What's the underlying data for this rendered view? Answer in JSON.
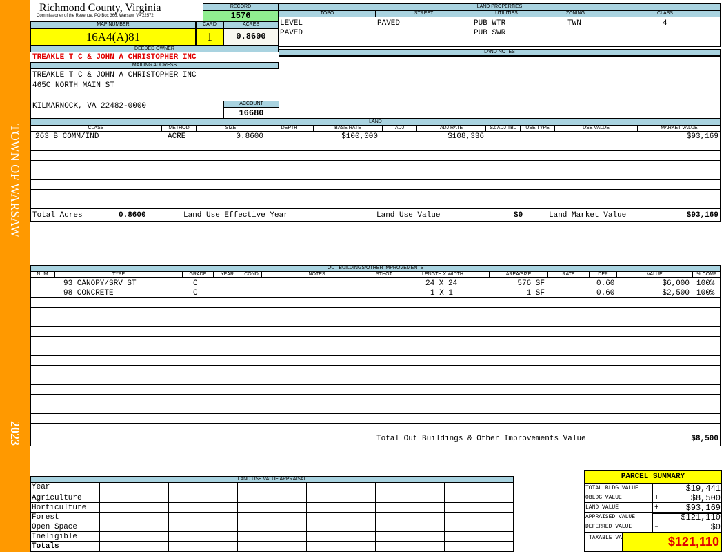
{
  "sidebar": {
    "town": "TOWN OF WARSAW",
    "year": "2023",
    "color": "#ff9900"
  },
  "header": {
    "county": "Richmond County, Virginia",
    "commissioner": "Commissioner of the Revenue, PO Box 366, Warsaw, VA 22572",
    "record_label": "RECORD",
    "record": "1576",
    "map_label": "MAP NUMBER",
    "map_number": "16A4(A)81",
    "card_label": "CARD",
    "card": "1",
    "acres_label": "ACRES",
    "acres": "0.8600"
  },
  "owner": {
    "label": "DEEDED OWNER",
    "name": "TREAKLE T C & JOHN A CHRISTOPHER INC",
    "mailing_label": "MAILING ADDRESS",
    "line1": "TREAKLE T C & JOHN A CHRISTOPHER INC",
    "line2": "465C NORTH MAIN ST",
    "line3": "KILMARNOCK, VA 22482-0000",
    "account_label": "ACCOUNT",
    "account": "16680"
  },
  "land_props": {
    "title": "LAND PROPERTIES",
    "headers": [
      "TOPO",
      "STREET",
      "UTILITIES",
      "ZONING",
      "CLASS"
    ],
    "topo": [
      "LEVEL",
      "PAVED"
    ],
    "street": "PAVED",
    "utilities": [
      "PUB WTR",
      "PUB SWR"
    ],
    "zoning": "TWN",
    "class": "4"
  },
  "land_notes": {
    "title": "LAND NOTES"
  },
  "land": {
    "title": "LAND",
    "headers": [
      "CLASS",
      "METHOD",
      "SIZE",
      "DEPTH",
      "BASE RATE",
      "ADJ",
      "ADJ RATE",
      "SZ ADJ TBL",
      "USE TYPE",
      "USE VALUE",
      "MARKET VALUE"
    ],
    "row": {
      "class": "263 B COMM/IND",
      "method": "ACRE",
      "size": "0.8600",
      "base_rate": "$100,000",
      "adj_rate": "$108,336",
      "market": "$93,169"
    },
    "total_acres_label": "Total Acres",
    "total_acres": "0.8600",
    "effective_year_label": "Land Use Effective Year",
    "use_value_label": "Land Use Value",
    "use_value": "$0",
    "market_value_label": "Land Market Value",
    "market_value": "$93,169"
  },
  "outbuildings": {
    "title": "OUT BUILDINGS/OTHER IMPROVEMENTS",
    "headers": [
      "NUM",
      "TYPE",
      "GRADE",
      "YEAR",
      "COND",
      "NOTES",
      "STHGT",
      "LENGTH X WIDTH",
      "AREA/SIZE",
      "RATE",
      "DEP",
      "VALUE",
      "% COMP"
    ],
    "rows": [
      {
        "type": "93 CANOPY/SRV ST",
        "grade": "C",
        "lw": "24 X 24",
        "area": "576 SF",
        "dep": "0.60",
        "value": "$6,000",
        "comp": "100%"
      },
      {
        "type": "98 CONCRETE",
        "grade": "C",
        "lw": "1 X 1",
        "area": "1 SF",
        "dep": "0.60",
        "value": "$2,500",
        "comp": "100%"
      }
    ],
    "total_label": "Total Out Buildings & Other Improvements Value",
    "total": "$8,500"
  },
  "luva": {
    "title": "LAND USE VALUE APPRAISAL",
    "rows": [
      "Year",
      "Agriculture",
      "Horticulture",
      "Forest",
      "Open Space",
      "Ineligible",
      "Totals"
    ]
  },
  "summary": {
    "title": "PARCEL SUMMARY",
    "rows": [
      {
        "label": "TOTAL BLDG VALUE",
        "op": "",
        "value": "$19,441"
      },
      {
        "label": "OBLDG VALUE",
        "op": "+",
        "value": "$8,500"
      },
      {
        "label": "LAND VALUE",
        "op": "+",
        "value": "$93,169"
      },
      {
        "label": "APPRAISED VALUE",
        "op": "",
        "value": "$121,110"
      },
      {
        "label": "DEFERRED VALUE",
        "op": "–",
        "value": "$0"
      }
    ],
    "taxable_label": "TAXABLE VALUE",
    "taxable": "$121,110"
  }
}
